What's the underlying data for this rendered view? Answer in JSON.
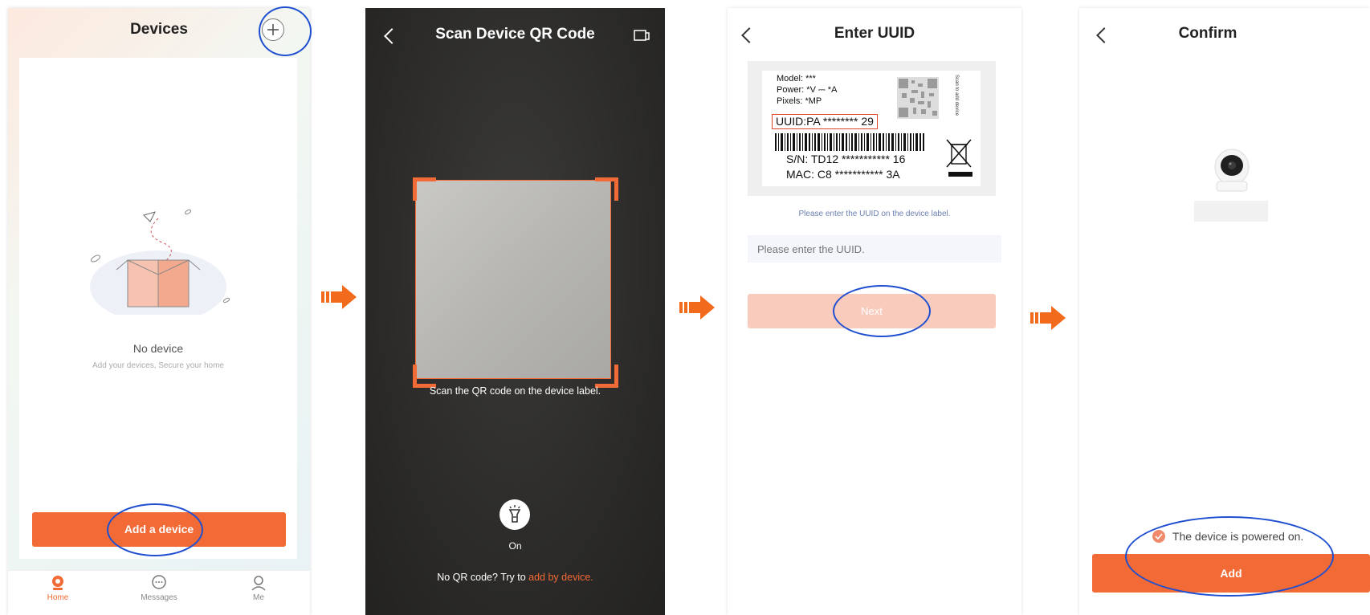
{
  "colors": {
    "accent": "#f26a35",
    "highlight_ellipse": "#1f4fd1"
  },
  "screen1": {
    "title": "Devices",
    "add_icon": "plus-icon",
    "empty_title": "No device",
    "empty_subtitle": "Add your devices, Secure your home",
    "add_button": "Add a device",
    "tabs": [
      {
        "label": "Home",
        "icon": "home-camera-icon",
        "active": true
      },
      {
        "label": "Messages",
        "icon": "chat-bubble-icon",
        "active": false
      },
      {
        "label": "Me",
        "icon": "profile-icon",
        "active": false
      }
    ]
  },
  "screen2": {
    "title": "Scan Device QR Code",
    "scan_hint": "Scan the QR code on the device label.",
    "flashlight_label": "On",
    "no_qr_text": "No QR code? Try to ",
    "no_qr_link": "add by device."
  },
  "screen3": {
    "title": "Enter UUID",
    "label": {
      "model": "Model:  ***",
      "power": "Power: *V ⎓ *A",
      "pixels": "Pixels: *MP",
      "uuid": "UUID:PA ******** 29",
      "sn": "S/N: TD12 *********** 16",
      "mac": "MAC: C8 *********** 3A",
      "side_text": "Scan to add device"
    },
    "hint": "Please enter the UUID on the device label.",
    "input_placeholder": "Please enter the UUID.",
    "next_button": "Next"
  },
  "screen4": {
    "title": "Confirm",
    "checkbox_label": "The device is powered on.",
    "add_button": "Add"
  }
}
